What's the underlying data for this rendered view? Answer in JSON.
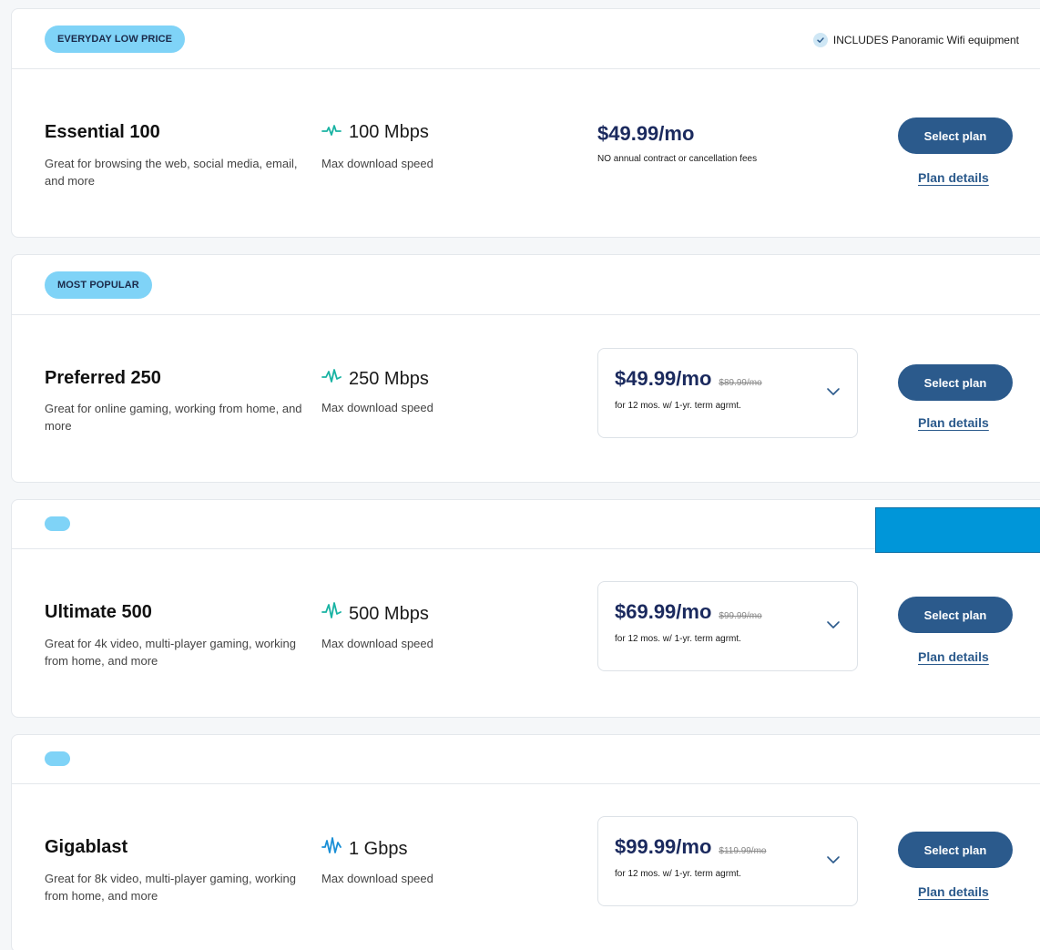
{
  "plans": [
    {
      "badge": "EVERYDAY LOW PRICE",
      "includes": "INCLUDES Panoramic Wifi equipment",
      "name": "Essential 100",
      "description": "Great for browsing the web, social media, email, and more",
      "speed": "100 Mbps",
      "speed_label": "Max download speed",
      "price": "$49.99/mo",
      "price_note": "NO annual contract or cancellation fees",
      "select_label": "Select plan",
      "details_label": "Plan details"
    },
    {
      "badge": "MOST POPULAR",
      "name": "Preferred 250",
      "description": "Great for online gaming, working from home, and more",
      "speed": "250 Mbps",
      "speed_label": "Max download speed",
      "price": "$49.99/mo",
      "old_price": "$89.99/mo",
      "price_term": "for 12 mos. w/ 1-yr. term agrmt.",
      "select_label": "Select plan",
      "details_label": "Plan details"
    },
    {
      "name": "Ultimate 500",
      "description": "Great for 4k video, multi-player gaming, working from home, and more",
      "speed": "500 Mbps",
      "speed_label": "Max download speed",
      "price": "$69.99/mo",
      "old_price": "$99.99/mo",
      "price_term": "for 12 mos. w/ 1-yr. term agrmt.",
      "select_label": "Select plan",
      "details_label": "Plan details"
    },
    {
      "name": "Gigablast",
      "description": "Great for 8k video, multi-player gaming, working from home, and more",
      "speed": "1 Gbps",
      "speed_label": "Max download speed",
      "price": "$99.99/mo",
      "old_price": "$119.99/mo",
      "price_term": "for 12 mos. w/ 1-yr. term agrmt.",
      "select_label": "Select plan",
      "details_label": "Plan details"
    }
  ],
  "colors": {
    "badge": "#7fd3f7",
    "price": "#1b2a5e",
    "button": "#2b5a8c",
    "speed_icon": "#19b3a3",
    "speed_icon_gig": "#1a8fd6",
    "overlay_block": "#0096d9"
  },
  "icons": {
    "speed": "pulse-icon",
    "check": "check-icon",
    "expand": "chevron-down-icon"
  }
}
